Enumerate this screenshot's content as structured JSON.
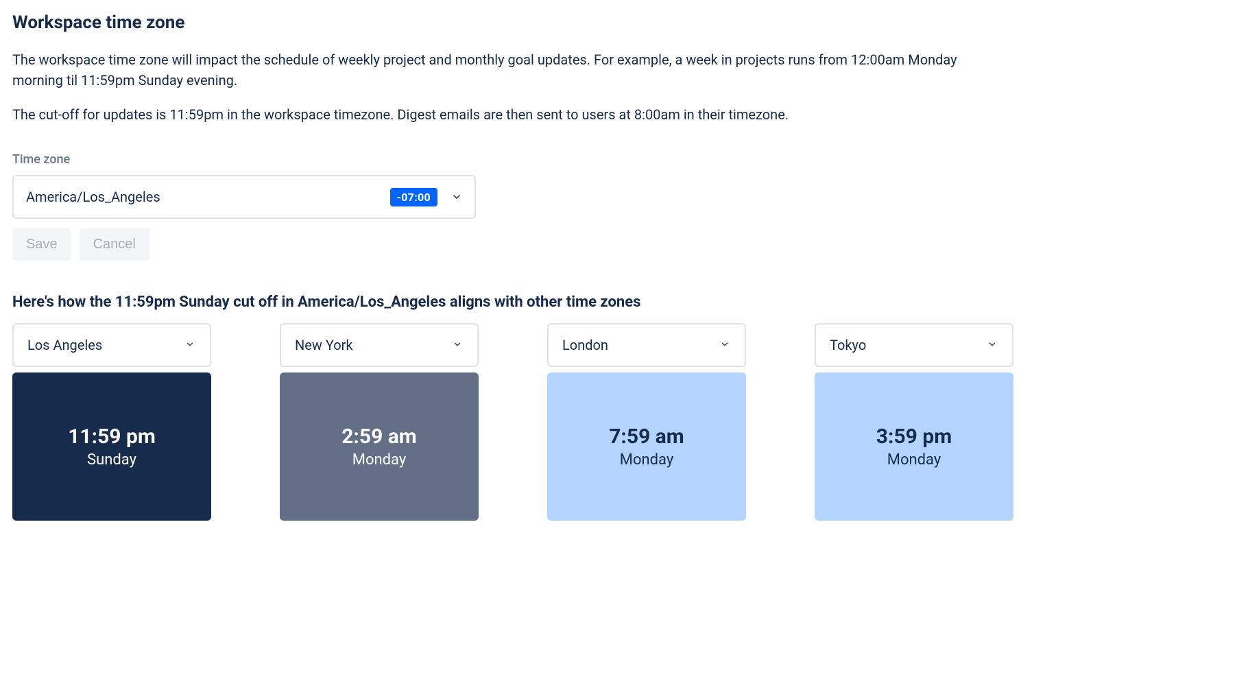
{
  "title": "Workspace time zone",
  "description1": "The workspace time zone will impact the schedule of weekly project and monthly goal updates. For example, a week in projects runs from 12:00am Monday morning til 11:59pm Sunday evening.",
  "description2": "The cut-off for updates is 11:59pm in the workspace timezone. Digest emails are then sent to users at 8:00am in their timezone.",
  "fieldLabel": "Time zone",
  "timezoneSelect": {
    "value": "America/Los_Angeles",
    "offset": "-07:00"
  },
  "buttons": {
    "save": "Save",
    "cancel": "Cancel"
  },
  "sectionHeading": "Here's how the 11:59pm Sunday cut off in America/Los_Angeles aligns with other time zones",
  "cards": [
    {
      "city": "Los Angeles",
      "time": "11:59 pm",
      "day": "Sunday"
    },
    {
      "city": "New York",
      "time": "2:59 am",
      "day": "Monday"
    },
    {
      "city": "London",
      "time": "7:59 am",
      "day": "Monday"
    },
    {
      "city": "Tokyo",
      "time": "3:59 pm",
      "day": "Monday"
    }
  ]
}
